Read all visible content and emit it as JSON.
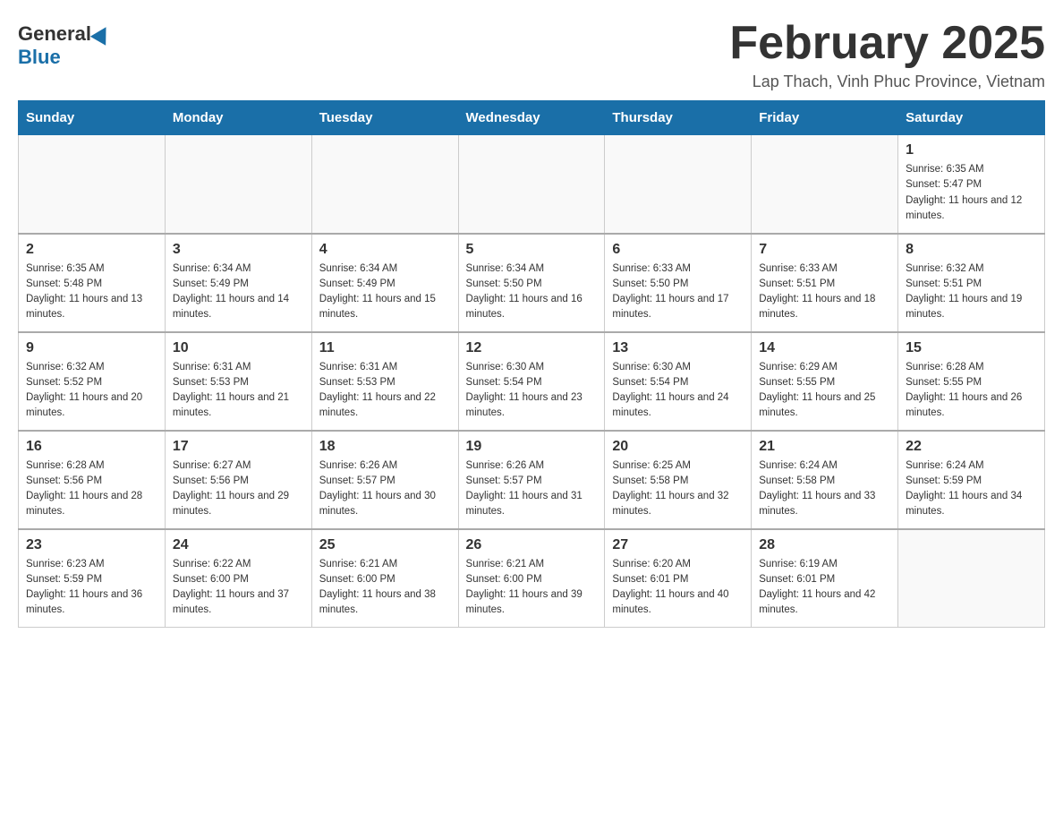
{
  "header": {
    "logo_general": "General",
    "logo_blue": "Blue",
    "month_title": "February 2025",
    "subtitle": "Lap Thach, Vinh Phuc Province, Vietnam"
  },
  "days_of_week": [
    "Sunday",
    "Monday",
    "Tuesday",
    "Wednesday",
    "Thursday",
    "Friday",
    "Saturday"
  ],
  "weeks": [
    {
      "days": [
        {
          "number": "",
          "info": ""
        },
        {
          "number": "",
          "info": ""
        },
        {
          "number": "",
          "info": ""
        },
        {
          "number": "",
          "info": ""
        },
        {
          "number": "",
          "info": ""
        },
        {
          "number": "",
          "info": ""
        },
        {
          "number": "1",
          "info": "Sunrise: 6:35 AM\nSunset: 5:47 PM\nDaylight: 11 hours and 12 minutes."
        }
      ]
    },
    {
      "days": [
        {
          "number": "2",
          "info": "Sunrise: 6:35 AM\nSunset: 5:48 PM\nDaylight: 11 hours and 13 minutes."
        },
        {
          "number": "3",
          "info": "Sunrise: 6:34 AM\nSunset: 5:49 PM\nDaylight: 11 hours and 14 minutes."
        },
        {
          "number": "4",
          "info": "Sunrise: 6:34 AM\nSunset: 5:49 PM\nDaylight: 11 hours and 15 minutes."
        },
        {
          "number": "5",
          "info": "Sunrise: 6:34 AM\nSunset: 5:50 PM\nDaylight: 11 hours and 16 minutes."
        },
        {
          "number": "6",
          "info": "Sunrise: 6:33 AM\nSunset: 5:50 PM\nDaylight: 11 hours and 17 minutes."
        },
        {
          "number": "7",
          "info": "Sunrise: 6:33 AM\nSunset: 5:51 PM\nDaylight: 11 hours and 18 minutes."
        },
        {
          "number": "8",
          "info": "Sunrise: 6:32 AM\nSunset: 5:51 PM\nDaylight: 11 hours and 19 minutes."
        }
      ]
    },
    {
      "days": [
        {
          "number": "9",
          "info": "Sunrise: 6:32 AM\nSunset: 5:52 PM\nDaylight: 11 hours and 20 minutes."
        },
        {
          "number": "10",
          "info": "Sunrise: 6:31 AM\nSunset: 5:53 PM\nDaylight: 11 hours and 21 minutes."
        },
        {
          "number": "11",
          "info": "Sunrise: 6:31 AM\nSunset: 5:53 PM\nDaylight: 11 hours and 22 minutes."
        },
        {
          "number": "12",
          "info": "Sunrise: 6:30 AM\nSunset: 5:54 PM\nDaylight: 11 hours and 23 minutes."
        },
        {
          "number": "13",
          "info": "Sunrise: 6:30 AM\nSunset: 5:54 PM\nDaylight: 11 hours and 24 minutes."
        },
        {
          "number": "14",
          "info": "Sunrise: 6:29 AM\nSunset: 5:55 PM\nDaylight: 11 hours and 25 minutes."
        },
        {
          "number": "15",
          "info": "Sunrise: 6:28 AM\nSunset: 5:55 PM\nDaylight: 11 hours and 26 minutes."
        }
      ]
    },
    {
      "days": [
        {
          "number": "16",
          "info": "Sunrise: 6:28 AM\nSunset: 5:56 PM\nDaylight: 11 hours and 28 minutes."
        },
        {
          "number": "17",
          "info": "Sunrise: 6:27 AM\nSunset: 5:56 PM\nDaylight: 11 hours and 29 minutes."
        },
        {
          "number": "18",
          "info": "Sunrise: 6:26 AM\nSunset: 5:57 PM\nDaylight: 11 hours and 30 minutes."
        },
        {
          "number": "19",
          "info": "Sunrise: 6:26 AM\nSunset: 5:57 PM\nDaylight: 11 hours and 31 minutes."
        },
        {
          "number": "20",
          "info": "Sunrise: 6:25 AM\nSunset: 5:58 PM\nDaylight: 11 hours and 32 minutes."
        },
        {
          "number": "21",
          "info": "Sunrise: 6:24 AM\nSunset: 5:58 PM\nDaylight: 11 hours and 33 minutes."
        },
        {
          "number": "22",
          "info": "Sunrise: 6:24 AM\nSunset: 5:59 PM\nDaylight: 11 hours and 34 minutes."
        }
      ]
    },
    {
      "days": [
        {
          "number": "23",
          "info": "Sunrise: 6:23 AM\nSunset: 5:59 PM\nDaylight: 11 hours and 36 minutes."
        },
        {
          "number": "24",
          "info": "Sunrise: 6:22 AM\nSunset: 6:00 PM\nDaylight: 11 hours and 37 minutes."
        },
        {
          "number": "25",
          "info": "Sunrise: 6:21 AM\nSunset: 6:00 PM\nDaylight: 11 hours and 38 minutes."
        },
        {
          "number": "26",
          "info": "Sunrise: 6:21 AM\nSunset: 6:00 PM\nDaylight: 11 hours and 39 minutes."
        },
        {
          "number": "27",
          "info": "Sunrise: 6:20 AM\nSunset: 6:01 PM\nDaylight: 11 hours and 40 minutes."
        },
        {
          "number": "28",
          "info": "Sunrise: 6:19 AM\nSunset: 6:01 PM\nDaylight: 11 hours and 42 minutes."
        },
        {
          "number": "",
          "info": ""
        }
      ]
    }
  ]
}
